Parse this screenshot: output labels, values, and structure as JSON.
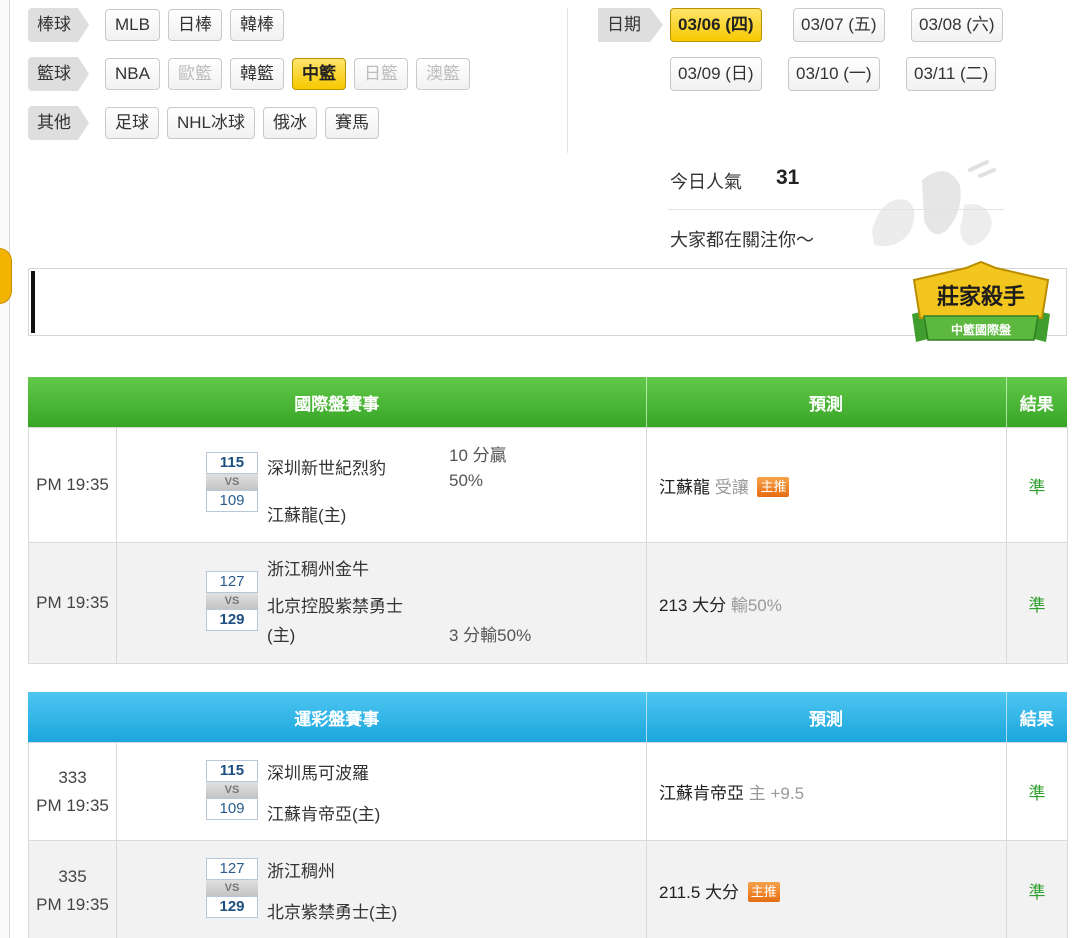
{
  "categories": [
    {
      "label": "棒球",
      "items": [
        {
          "text": "MLB",
          "state": "normal"
        },
        {
          "text": "日棒",
          "state": "normal"
        },
        {
          "text": "韓棒",
          "state": "normal"
        }
      ]
    },
    {
      "label": "籃球",
      "items": [
        {
          "text": "NBA",
          "state": "normal"
        },
        {
          "text": "歐籃",
          "state": "disabled"
        },
        {
          "text": "韓籃",
          "state": "normal"
        },
        {
          "text": "中籃",
          "state": "active"
        },
        {
          "text": "日籃",
          "state": "disabled"
        },
        {
          "text": "澳籃",
          "state": "disabled"
        }
      ]
    },
    {
      "label": "其他",
      "items": [
        {
          "text": "足球",
          "state": "normal"
        },
        {
          "text": "NHL冰球",
          "state": "normal"
        },
        {
          "text": "俄冰",
          "state": "normal"
        },
        {
          "text": "賽馬",
          "state": "normal"
        }
      ]
    }
  ],
  "dates": {
    "label": "日期",
    "items": [
      {
        "text": "03/06 (四)",
        "active": true
      },
      {
        "text": "03/07 (五)",
        "active": false
      },
      {
        "text": "03/08 (六)",
        "active": false
      },
      {
        "text": "03/09 (日)",
        "active": false
      },
      {
        "text": "03/10 (一)",
        "active": false
      },
      {
        "text": "03/11 (二)",
        "active": false
      }
    ]
  },
  "popularity": {
    "label": "今日人氣",
    "value": "31",
    "message": "大家都在關注你～"
  },
  "badge": {
    "title": "莊家殺手",
    "subtitle": "中籃國際盤"
  },
  "intl_table": {
    "headers": {
      "match": "國際盤賽事",
      "prediction": "預測",
      "result": "結果"
    },
    "rows": [
      {
        "no": "",
        "time": "PM 19:35",
        "score_a": "115",
        "score_b": "109",
        "vs": "VS",
        "team_a": "深圳新世紀烈豹",
        "team_b": "江蘇龍(主)",
        "odds_line1": "10 分贏",
        "odds_line2": "50%",
        "pred_main": "江蘇龍",
        "pred_sub": "受讓",
        "pred_tag": "主推",
        "result": "準"
      },
      {
        "no": "",
        "time": "PM 19:35",
        "score_a": "127",
        "score_b": "129",
        "vs": "VS",
        "team_a": "浙江稠州金牛",
        "team_b_l1": "北京控股紫禁勇士",
        "team_b_l2": "(主)",
        "odds": "3 分輸50%",
        "pred_main": "213 大分",
        "pred_sub": "輸50%",
        "pred_tag": "",
        "result": "準"
      }
    ]
  },
  "lottery_table": {
    "headers": {
      "match": "運彩盤賽事",
      "prediction": "預測",
      "result": "結果"
    },
    "rows": [
      {
        "no": "333",
        "time": "PM 19:35",
        "score_a": "115",
        "score_b": "109",
        "vs": "VS",
        "team_a": "深圳馬可波羅",
        "team_b": "江蘇肯帝亞(主)",
        "pred_main": "江蘇肯帝亞",
        "pred_sub": "主 +9.5",
        "pred_tag": "",
        "result": "準"
      },
      {
        "no": "335",
        "time": "PM 19:35",
        "score_a": "127",
        "score_b": "129",
        "vs": "VS",
        "team_a": "浙江稠州",
        "team_b": "北京紫禁勇士(主)",
        "pred_main": "211.5 大分",
        "pred_sub": "",
        "pred_tag": "主推",
        "result": "準"
      }
    ]
  },
  "colors": {
    "active_chip": "#f7c900",
    "intl_header": "#38a526",
    "lottery_header": "#1ba6dd",
    "result": "#2f9f2f",
    "tag": "#e66d12"
  }
}
